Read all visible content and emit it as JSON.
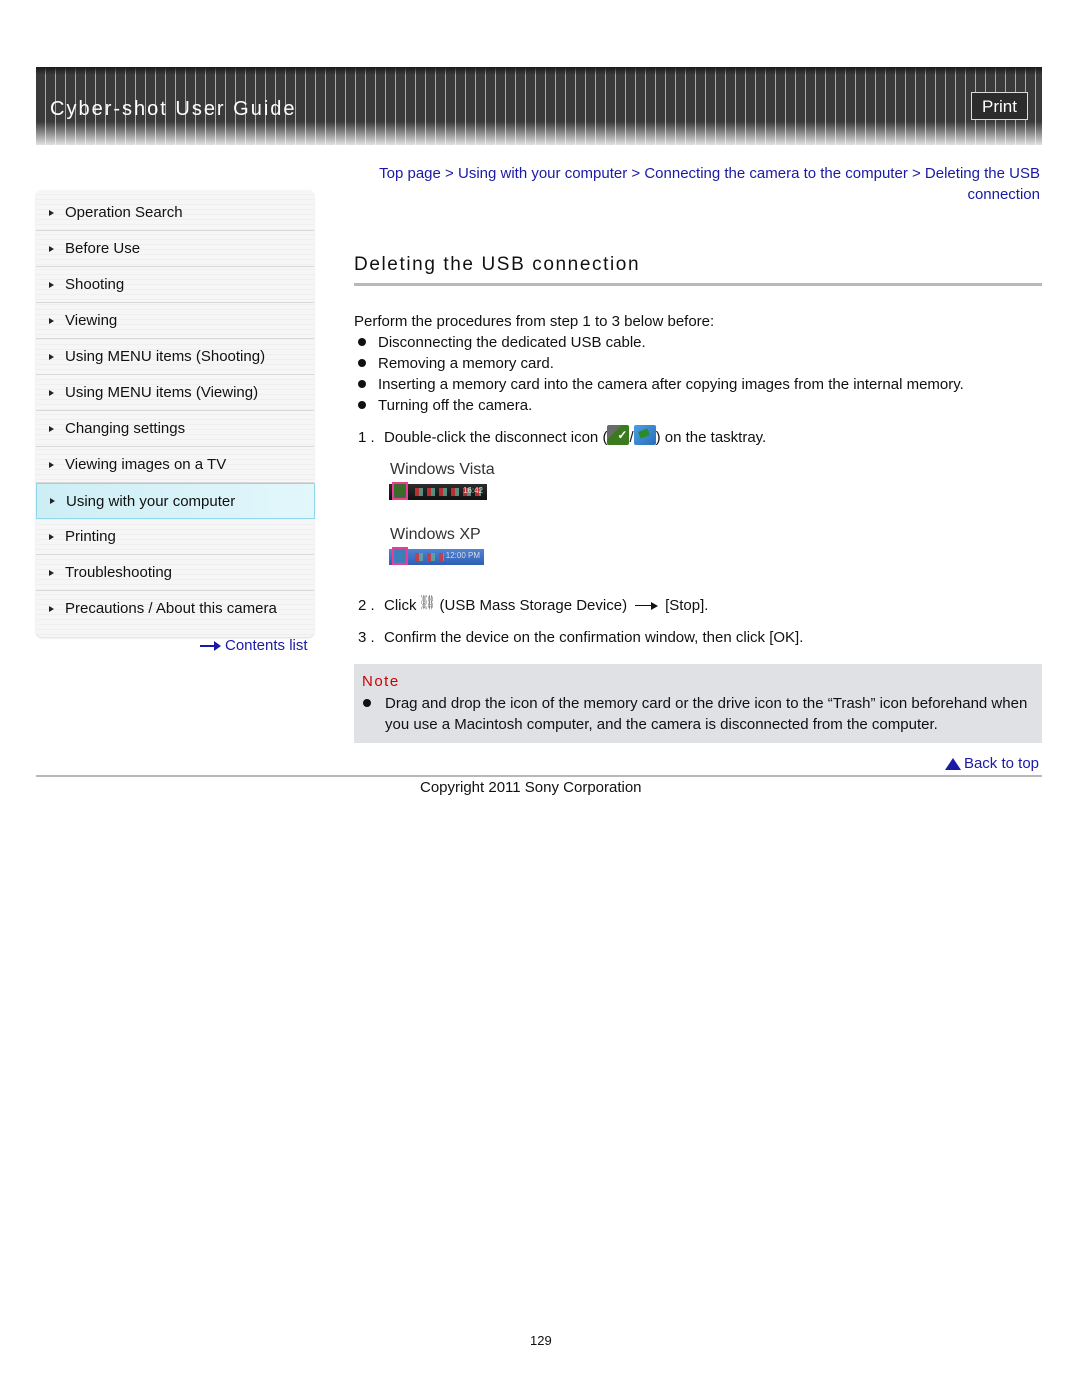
{
  "header": {
    "title": "Cyber-shot User Guide",
    "print_label": "Print"
  },
  "sidebar": {
    "items": [
      {
        "label": "Operation Search",
        "active": false
      },
      {
        "label": "Before Use",
        "active": false
      },
      {
        "label": "Shooting",
        "active": false
      },
      {
        "label": "Viewing",
        "active": false
      },
      {
        "label": "Using MENU items (Shooting)",
        "active": false
      },
      {
        "label": "Using MENU items (Viewing)",
        "active": false
      },
      {
        "label": "Changing settings",
        "active": false
      },
      {
        "label": "Viewing images on a TV",
        "active": false
      },
      {
        "label": "Using with your computer",
        "active": true
      },
      {
        "label": "Printing",
        "active": false
      },
      {
        "label": "Troubleshooting",
        "active": false
      },
      {
        "label": "Precautions / About this camera",
        "active": false
      }
    ],
    "contents_link": "Contents list"
  },
  "breadcrumb": {
    "items": [
      "Top page",
      "Using with your computer",
      "Connecting the camera to the computer",
      "Deleting the USB connection"
    ],
    "separator": ">"
  },
  "main": {
    "title": "Deleting the USB connection",
    "intro": "Perform the procedures from step 1  to 3  below before:",
    "bullets": [
      "Disconnecting the dedicated USB cable.",
      "Removing a memory card.",
      "Inserting a memory card into the camera after copying images from the internal memory.",
      "Turning off the camera."
    ],
    "steps": [
      {
        "num": "1 .",
        "before": "Double-click the disconnect icon (",
        "sep": "/",
        "after": ") on the tasktray."
      },
      {
        "num": "2 .",
        "before": "Click",
        "middle": "(USB Mass Storage Device)",
        "after": "[Stop]."
      },
      {
        "num": "3 .",
        "text": "Confirm the device on the confirmation window, then click [OK]."
      }
    ],
    "os_labels": {
      "vista": "Windows Vista",
      "xp": "Windows XP"
    },
    "tray_clocks": {
      "vista": "16:42",
      "xp": "12:00 PM"
    },
    "note": {
      "title": "Note",
      "text": "Drag and drop the icon of the memory card or the drive icon to the “Trash” icon beforehand when you use a Macintosh computer, and the camera is disconnected from the computer."
    }
  },
  "footer": {
    "back_to_top": "Back to top",
    "copyright": "Copyright 2011 Sony Corporation",
    "page_number": "129"
  }
}
